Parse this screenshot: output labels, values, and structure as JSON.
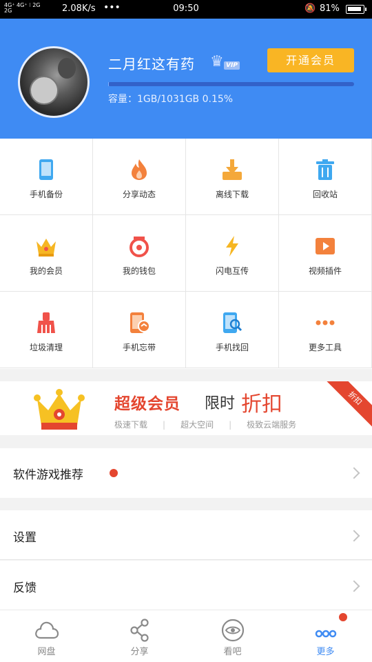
{
  "status_bar": {
    "network_top": "4G⁺ 4G⁺ ⁝ 2G",
    "network_bottom": "2G",
    "speed": "2.08K/s",
    "more": "•••",
    "time": "09:50",
    "battery": "81%"
  },
  "header": {
    "username": "二月红这有药",
    "vip_label": "VIP",
    "member_button": "开通会员",
    "storage_used_fraction": 0.0015,
    "capacity_text": "容量：1GB/1031GB 0.15%"
  },
  "grid": {
    "items": [
      {
        "label": "手机备份",
        "icon": "phone-backup-icon",
        "color": "#3fa8f0"
      },
      {
        "label": "分享动态",
        "icon": "flame-icon",
        "color": "#f3813c"
      },
      {
        "label": "离线下载",
        "icon": "download-icon",
        "color": "#f4a83a"
      },
      {
        "label": "回收站",
        "icon": "trash-icon",
        "color": "#3fa8f0"
      },
      {
        "label": "我的会员",
        "icon": "crown-icon",
        "color": "#f6b623"
      },
      {
        "label": "我的钱包",
        "icon": "wallet-icon",
        "color": "#f0524a"
      },
      {
        "label": "闪电互传",
        "icon": "lightning-icon",
        "color": "#f6b623"
      },
      {
        "label": "视频插件",
        "icon": "video-icon",
        "color": "#f3813c"
      },
      {
        "label": "垃圾清理",
        "icon": "broom-icon",
        "color": "#f0524a"
      },
      {
        "label": "手机忘带",
        "icon": "phone-cloud-icon",
        "color": "#f3813c"
      },
      {
        "label": "手机找回",
        "icon": "phone-search-icon",
        "color": "#3fa8f0"
      },
      {
        "label": "更多工具",
        "icon": "more-dots-icon",
        "color": "#f3813c"
      }
    ]
  },
  "banner": {
    "title": "超级会员",
    "middle": "限时",
    "highlight": "折扣",
    "features": [
      "极速下载",
      "超大空间",
      "极致云端服务"
    ],
    "ribbon": "折扣"
  },
  "menu": {
    "software": "软件游戏推荐",
    "settings": "设置",
    "feedback": "反馈"
  },
  "tabs": [
    {
      "label": "网盘",
      "icon": "cloud-icon"
    },
    {
      "label": "分享",
      "icon": "share-icon"
    },
    {
      "label": "看吧",
      "icon": "eye-icon"
    },
    {
      "label": "更多",
      "icon": "more-icon"
    }
  ],
  "colors": {
    "header_blue": "#3f8bf3",
    "accent_orange": "#f9b524",
    "accent_red": "#e4462f"
  }
}
